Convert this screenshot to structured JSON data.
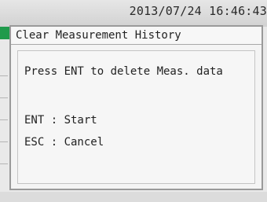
{
  "status_bar": {
    "timestamp": "2013/07/24 16:46:43"
  },
  "dialog": {
    "title": "Clear Measurement History",
    "message": "Press ENT to delete Meas. data",
    "options": [
      {
        "key_label": "ENT : Start"
      },
      {
        "key_label": "ESC : Cancel"
      }
    ]
  },
  "colors": {
    "status_bar_bg": "#d8d8d8",
    "marker_green": "#1f9a4b",
    "dialog_bg": "#f4f4f4",
    "dialog_border": "#9a9a9a",
    "text": "#222222"
  }
}
